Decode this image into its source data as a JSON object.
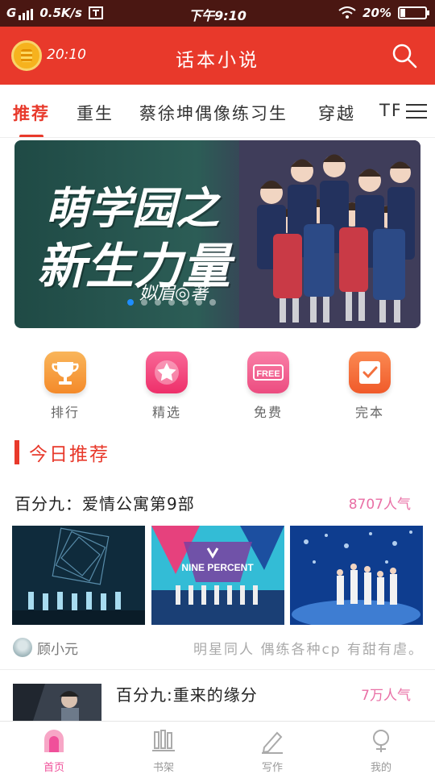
{
  "status_bar": {
    "carrier": "G",
    "speed": "0.5K/s",
    "time": "下午9:10",
    "battery": "20%",
    "battery_level": 0.2
  },
  "header": {
    "clock_time": "20:10",
    "title": "话本小说"
  },
  "tabs": [
    "推荐",
    "重生",
    "蔡徐坤偶像练习生",
    "穿越",
    "TFI"
  ],
  "active_tab": 0,
  "banner": {
    "title_line1": "萌学园之",
    "title_line2": "新生力量",
    "author": "姒眉◎著",
    "page_count": 7,
    "active_page": 0
  },
  "quick_entries": [
    {
      "label": "排行",
      "icon": "trophy-icon",
      "color": "#f7a23b"
    },
    {
      "label": "精选",
      "icon": "star-icon",
      "color": "#f0457c"
    },
    {
      "label": "免费",
      "icon": "free-tag-icon",
      "color": "#ef5b8c",
      "icon_text": "FREE"
    },
    {
      "label": "完本",
      "icon": "checklist-icon",
      "color": "#f36b3e"
    }
  ],
  "section": {
    "title": "今日推荐"
  },
  "books": [
    {
      "title": "百分九：爱情公寓第9部",
      "popularity": "8707人气",
      "author": "顾小元",
      "tags": "明星同人  偶练各种cp  有甜有虐。",
      "thumb_text": "NINE PERCENT"
    },
    {
      "title": "百分九:重来的缘分",
      "popularity": "7万人气"
    }
  ],
  "bottom_nav": [
    "首页",
    "书架",
    "写作",
    "我的"
  ],
  "colors": {
    "brand_red": "#e8392b",
    "popularity_pink": "#e96fa5",
    "nav_active": "#f0509a"
  }
}
